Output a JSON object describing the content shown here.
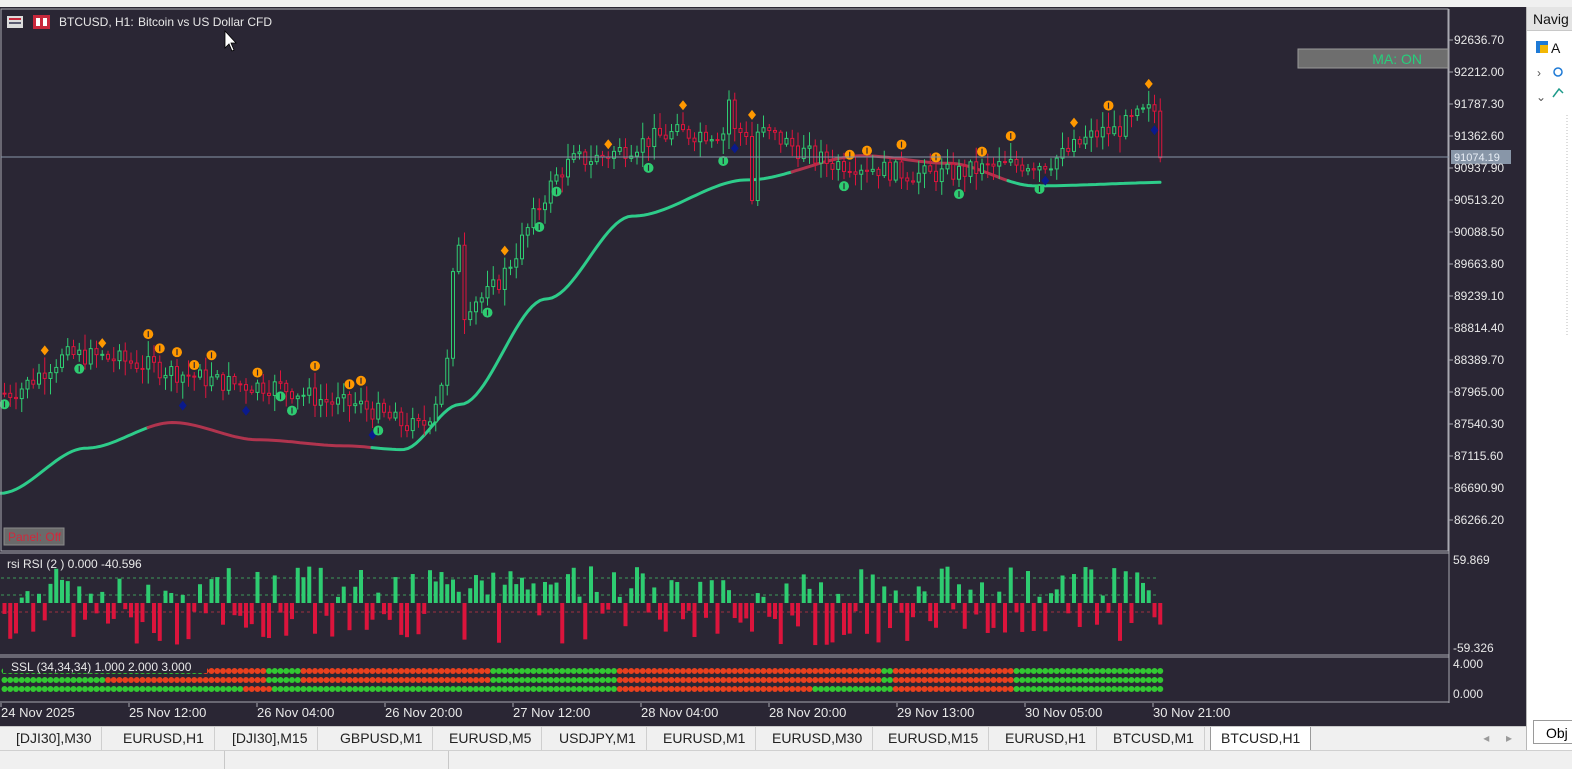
{
  "window": {
    "symbol_label": "BTCUSD, H1:",
    "description": "Bitcoin vs US Dollar CFD"
  },
  "panels": {
    "ma_button": "MA: ON",
    "panel_button": "Panel: Off"
  },
  "price_axis": {
    "labels": [
      "92636.70",
      "92212.00",
      "91787.30",
      "91362.60",
      "90937.90",
      "90513.20",
      "90088.50",
      "89663.80",
      "89239.10",
      "88814.40",
      "88389.70",
      "87965.00",
      "87540.30",
      "87115.60",
      "86690.90",
      "86266.20"
    ],
    "current_price": "91074.19"
  },
  "rsi": {
    "label": "rsi RSI (2 ) 0.000 -40.596",
    "max_label": "59.869",
    "min_label": "-59.326"
  },
  "ssl": {
    "label": "SSL (34,34,34) 1.000 2.000 3.000",
    "max_label": "4.000",
    "min_label": "0.000"
  },
  "time_axis": {
    "labels": [
      "24 Nov 2025",
      "25 Nov 12:00",
      "26 Nov 04:00",
      "26 Nov 20:00",
      "27 Nov 12:00",
      "28 Nov 04:00",
      "28 Nov 20:00",
      "29 Nov 13:00",
      "30 Nov 05:00",
      "30 Nov 21:00"
    ]
  },
  "tabs": [
    {
      "label": "[DJI30],M30"
    },
    {
      "label": "EURUSD,H1"
    },
    {
      "label": "[DJI30],M15"
    },
    {
      "label": "GBPUSD,M1"
    },
    {
      "label": "EURUSD,M5"
    },
    {
      "label": "USDJPY,M1"
    },
    {
      "label": "EURUSD,M1"
    },
    {
      "label": "EURUSD,M30"
    },
    {
      "label": "EURUSD,M15"
    },
    {
      "label": "EURUSD,H1"
    },
    {
      "label": "BTCUSD,M1"
    },
    {
      "label": "BTCUSD,H1"
    }
  ],
  "active_tab": "BTCUSD,H1",
  "navigator": {
    "title": "Navig",
    "bottom_tab": "Obj"
  },
  "colors": {
    "background": "#2a2634",
    "bull": "#2ecc71",
    "bear": "#dc143c",
    "ma_line": "#2ecc8a",
    "ma_flat": "#b0344e",
    "signal": "#ff9800",
    "diamond_dark": "#0a1a8c",
    "ssl_green": "#32c832",
    "ssl_red": "#e8401e"
  },
  "chart_data": [
    {
      "type": "candlestick",
      "title": "BTCUSD, H1: Bitcoin vs US Dollar CFD",
      "ylim": [
        86100,
        92900
      ],
      "x_ticks": [
        "24 Nov 2025",
        "25 Nov 12:00",
        "26 Nov 04:00",
        "26 Nov 20:00",
        "27 Nov 12:00",
        "28 Nov 04:00",
        "28 Nov 20:00",
        "29 Nov 13:00",
        "30 Nov 05:00",
        "30 Nov 21:00"
      ],
      "trend_keypoints": [
        [
          0,
          87950
        ],
        [
          12,
          88450
        ],
        [
          45,
          88050
        ],
        [
          60,
          87800
        ],
        [
          72,
          87500
        ],
        [
          82,
          89200
        ],
        [
          100,
          91050
        ],
        [
          118,
          91400
        ],
        [
          130,
          91420
        ],
        [
          145,
          91000
        ],
        [
          160,
          90850
        ],
        [
          180,
          91000
        ],
        [
          192,
          91420
        ],
        [
          200,
          91700
        ]
      ],
      "ma_keypoints": [
        [
          0,
          86620
        ],
        [
          15,
          87220
        ],
        [
          30,
          87560
        ],
        [
          45,
          87330
        ],
        [
          60,
          87250
        ],
        [
          70,
          87200
        ],
        [
          80,
          87800
        ],
        [
          95,
          89200
        ],
        [
          110,
          90300
        ],
        [
          130,
          90780
        ],
        [
          150,
          91100
        ],
        [
          165,
          91000
        ],
        [
          180,
          90700
        ],
        [
          205,
          90750
        ],
        [
          220,
          90950
        ],
        [
          232,
          91150
        ]
      ],
      "last_price": 91074.19
    },
    {
      "type": "bar",
      "title": "rsi RSI (2 ) 0.000 -40.596",
      "ylim": [
        -59.326,
        59.869
      ]
    },
    {
      "type": "heatmap",
      "title": "SSL (34,34,34) 1.000 2.000 3.000",
      "ylim": [
        0,
        4
      ],
      "rows": [
        {
          "level": 3,
          "red_ranges": [
            [
              35,
              45
            ],
            [
              52,
              84
            ],
            [
              107,
              152
            ],
            [
              155,
              175
            ]
          ]
        },
        {
          "level": 2,
          "red_ranges": [
            [
              18,
              45
            ],
            [
              52,
              84
            ],
            [
              107,
              152
            ],
            [
              155,
              175
            ]
          ]
        },
        {
          "level": 1,
          "red_ranges": [
            [
              42,
              46
            ],
            [
              107,
              140
            ],
            [
              155,
              175
            ]
          ]
        }
      ]
    }
  ]
}
